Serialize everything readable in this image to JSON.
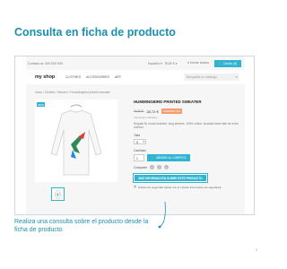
{
  "heading": "Consulta en ficha de producto",
  "callout": "Realiza una consulta sobre el producto desde la ficha de producto",
  "page_number": "9",
  "shop": {
    "topbar": {
      "contact": "Contact us: 933 000 000",
      "language": "Español ▾",
      "currency": "EUR € ▾",
      "login": "Iniciar sesión",
      "cart": "Carrito (0)"
    },
    "logo": "my shop",
    "nav": [
      "CLOTHES",
      "ACCESSORIES",
      "ART"
    ],
    "search_placeholder": "Búsqueda en catálogo",
    "breadcrumb": "Inicio / Clothes / Women / Hummingbird printed sweater",
    "new_flag": "NEW",
    "product": {
      "title": "HUMMINGBIRD PRINTED SWEATER",
      "old_price": "35,90 €",
      "price": "28,72 €",
      "discount_badge": "AHORRE 20%",
      "taxes": "Impuestos incluidos",
      "short_description": "Regular fit, round neckline, long sleeves. 100% cotton, brushed inner side for extra comfort.",
      "size_label": "Talla",
      "size_value": "S",
      "qty_label": "Cantidad",
      "qty_value": "1",
      "add_to_cart": "AÑADIR AL CARRITO",
      "share_label": "Compartir",
      "share_icons": [
        "f",
        "t",
        "p"
      ],
      "info_button": "MÁS INFORMACIÓN SOBRE ESTE PRODUCTO",
      "policy": "Política de seguridad (editar con el módulo Información de seguridad)"
    }
  },
  "colors": {
    "accent": "#1c8fb0",
    "shop_blue": "#2fb5d2",
    "discount": "#f39d72"
  }
}
